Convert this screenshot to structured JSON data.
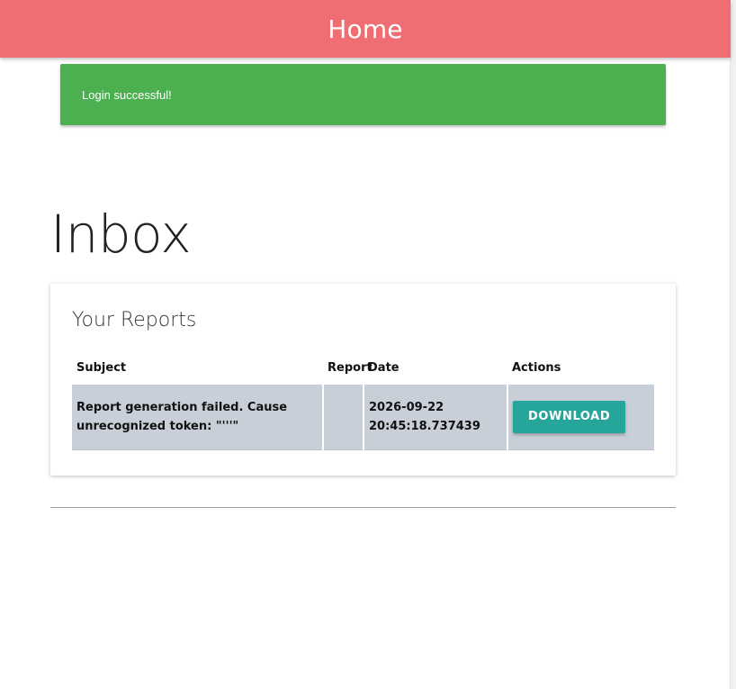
{
  "navbar": {
    "brand": "Home"
  },
  "toast": {
    "message": "Login successful!"
  },
  "page": {
    "heading": "Inbox"
  },
  "reports_card": {
    "title": "Your Reports",
    "columns": [
      "Subject",
      "Report",
      "Date",
      "Actions"
    ],
    "rows": [
      {
        "subject": "Report generation failed. Cause unrecognized token: \"'''\"",
        "report": "",
        "date": "2026-09-22 20:45:18.737439",
        "action_label": "DOWNLOAD"
      }
    ]
  },
  "colors": {
    "navbar": "#ef6e73",
    "toast": "#4caf50",
    "button": "#26a69a",
    "row": "#c8cfd8"
  }
}
